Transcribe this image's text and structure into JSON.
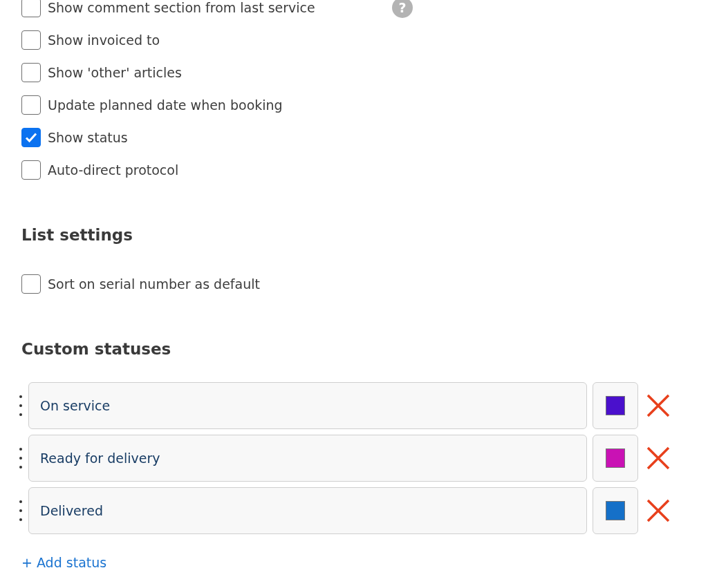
{
  "options": [
    {
      "label": "Show comment section from last service",
      "checked": false,
      "help_icon": "?"
    },
    {
      "label": "Show invoiced to",
      "checked": false
    },
    {
      "label": "Show 'other' articles",
      "checked": false
    },
    {
      "label": "Update planned date when booking",
      "checked": false
    },
    {
      "label": "Show status",
      "checked": true
    },
    {
      "label": "Auto-direct protocol",
      "checked": false
    }
  ],
  "list_settings": {
    "heading": "List settings",
    "options": [
      {
        "label": "Sort on serial number as default",
        "checked": false
      }
    ]
  },
  "custom_statuses": {
    "heading": "Custom statuses",
    "items": [
      {
        "name": "On service",
        "color": "#4a10cc"
      },
      {
        "name": "Ready for delivery",
        "color": "#c912b4"
      },
      {
        "name": "Delivered",
        "color": "#1570c8"
      }
    ],
    "add_link": "+ Add status"
  }
}
